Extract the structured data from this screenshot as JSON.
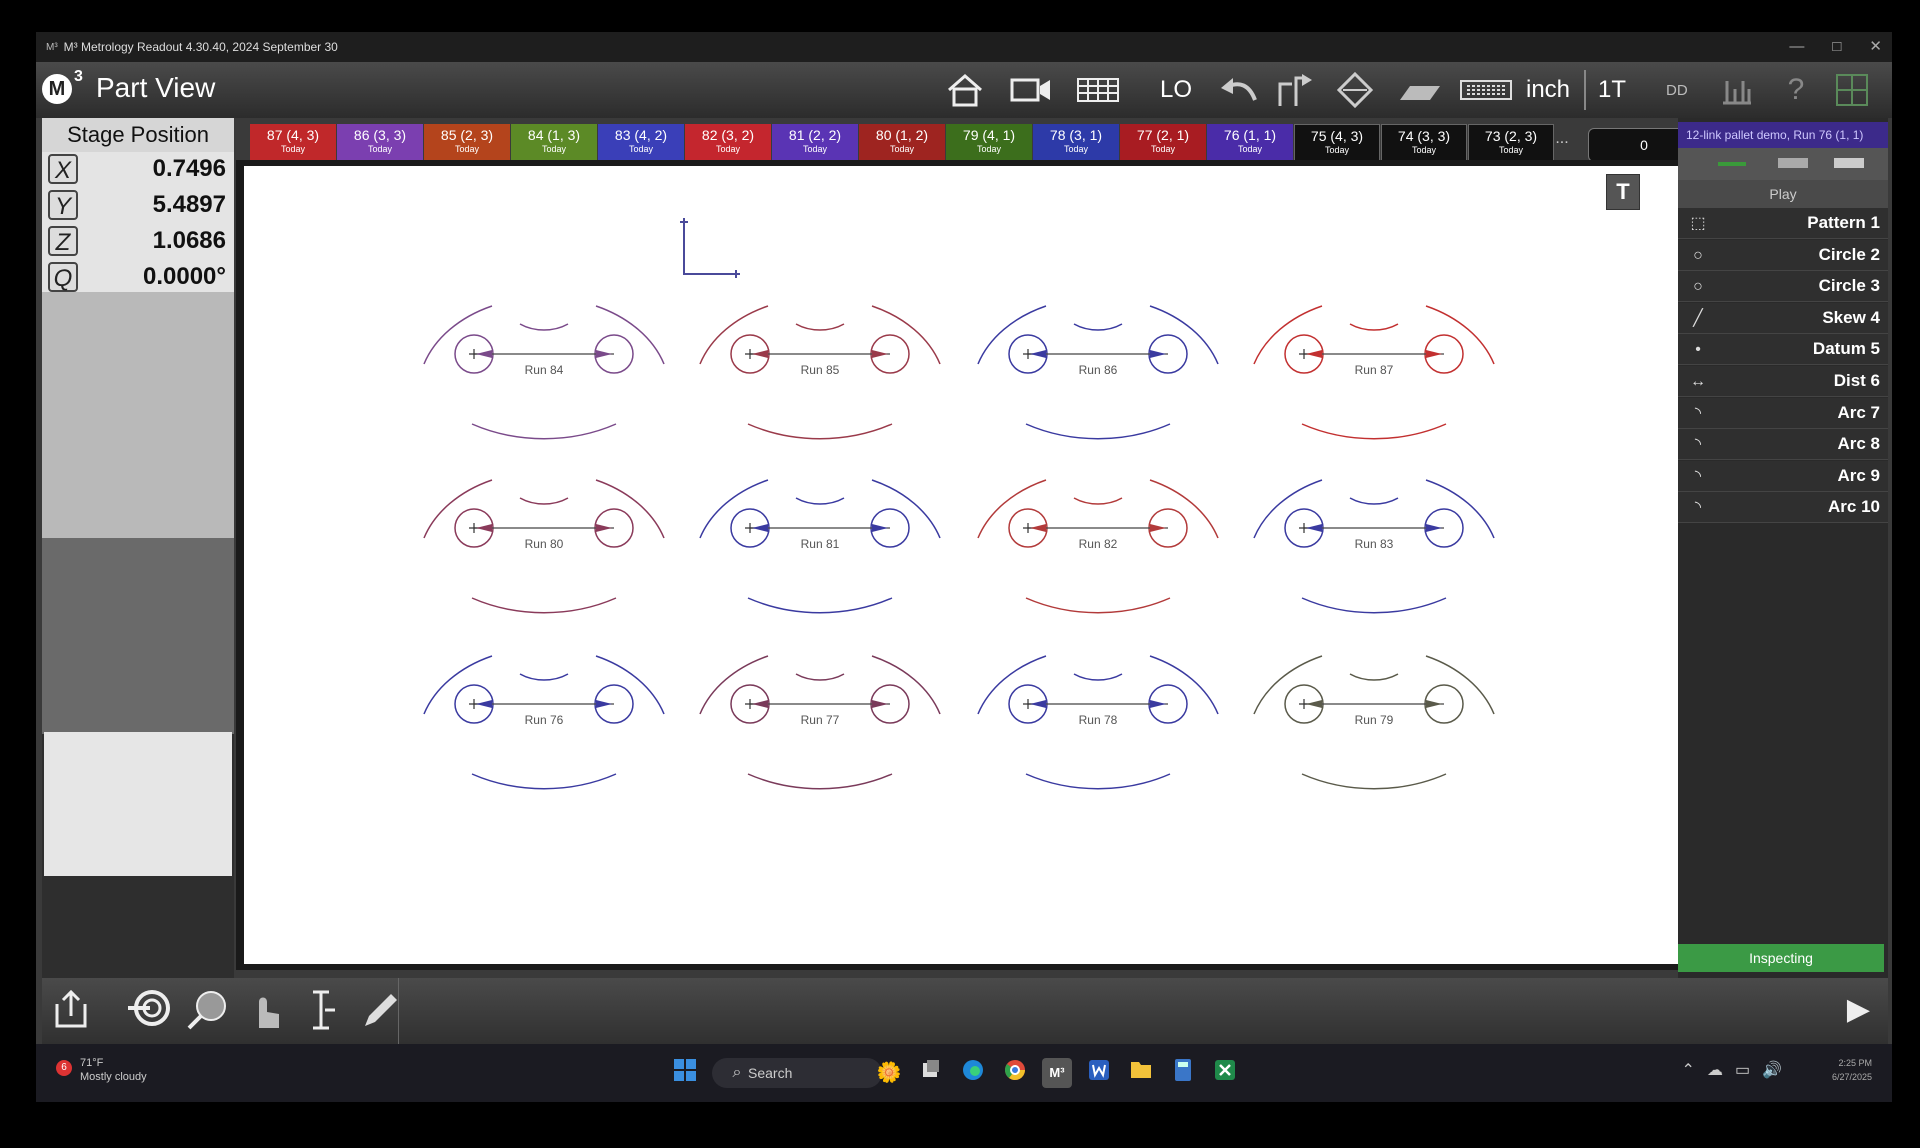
{
  "window": {
    "title": "M³ Metrology Readout  4.30.40, 2024 September 30",
    "controls": [
      "—",
      "□",
      "✕"
    ]
  },
  "header": {
    "logo": "M",
    "logo_sup": "3",
    "view_title": "Part View",
    "mode_text": "LO",
    "units": "inch",
    "probe": "1T",
    "angle_format": "DD"
  },
  "stage": {
    "title": "Stage Position",
    "axes": [
      {
        "axis": "X",
        "value": "0.7496"
      },
      {
        "axis": "Y",
        "value": "5.4897"
      },
      {
        "axis": "Z",
        "value": "1.0686"
      },
      {
        "axis": "Q",
        "value": "0.0000°"
      }
    ]
  },
  "tabs": [
    {
      "label": "87 (4, 3)",
      "sub": "Today",
      "color": "#c0282a"
    },
    {
      "label": "86 (3, 3)",
      "sub": "Today",
      "color": "#7b3fb0"
    },
    {
      "label": "85 (2, 3)",
      "sub": "Today",
      "color": "#b4441c"
    },
    {
      "label": "84 (1, 3)",
      "sub": "Today",
      "color": "#5c8a26"
    },
    {
      "label": "83 (4, 2)",
      "sub": "Today",
      "color": "#3a3fb8"
    },
    {
      "label": "82 (3, 2)",
      "sub": "Today",
      "color": "#c4262e"
    },
    {
      "label": "81 (2, 2)",
      "sub": "Today",
      "color": "#5a34b4"
    },
    {
      "label": "80 (1, 2)",
      "sub": "Today",
      "color": "#9e2420"
    },
    {
      "label": "79 (4, 1)",
      "sub": "Today",
      "color": "#3c6e1c"
    },
    {
      "label": "78 (3, 1)",
      "sub": "Today",
      "color": "#2d3aa8"
    },
    {
      "label": "77 (2, 1)",
      "sub": "Today",
      "color": "#a81c22"
    },
    {
      "label": "76 (1, 1)",
      "sub": "Today",
      "color": "#4a2ca8"
    },
    {
      "label": "75 (4, 3)",
      "sub": "Today",
      "color": "#111111"
    },
    {
      "label": "74 (3, 3)",
      "sub": "Today",
      "color": "#111111"
    },
    {
      "label": "73 (2, 3)",
      "sub": "Today",
      "color": "#111111"
    }
  ],
  "tabs_more": "...",
  "counter": "0",
  "canvas_button": "T",
  "runs": [
    {
      "label": "Run 84",
      "color": "#7a4a8a"
    },
    {
      "label": "Run 85",
      "color": "#9a3a4a"
    },
    {
      "label": "Run 86",
      "color": "#3a3aa0"
    },
    {
      "label": "Run 87",
      "color": "#c23030"
    },
    {
      "label": "Run 80",
      "color": "#8a3a5a"
    },
    {
      "label": "Run 81",
      "color": "#3a3aa0"
    },
    {
      "label": "Run 82",
      "color": "#b23a3a"
    },
    {
      "label": "Run 83",
      "color": "#3a3aa0"
    },
    {
      "label": "Run 76",
      "color": "#3a3aa0"
    },
    {
      "label": "Run 77",
      "color": "#7a3a5a"
    },
    {
      "label": "Run 78",
      "color": "#3a3aa0"
    },
    {
      "label": "Run 79",
      "color": "#5a5a4a"
    }
  ],
  "rightpanel": {
    "header": "12-link pallet demo, Run 76 (1, 1)",
    "play_label": "Play",
    "features": [
      {
        "label": "Pattern 1",
        "icon": "pattern-icon",
        "glyph": "⬚"
      },
      {
        "label": "Circle 2",
        "icon": "circle-icon",
        "glyph": "○"
      },
      {
        "label": "Circle 3",
        "icon": "circle-icon",
        "glyph": "○"
      },
      {
        "label": "Skew 4",
        "icon": "line-icon",
        "glyph": "╱"
      },
      {
        "label": "Datum 5",
        "icon": "point-icon",
        "glyph": "•"
      },
      {
        "label": "Dist 6",
        "icon": "distance-icon",
        "glyph": "↔"
      },
      {
        "label": "Arc 7",
        "icon": "arc-icon",
        "glyph": "◝"
      },
      {
        "label": "Arc 8",
        "icon": "arc-icon",
        "glyph": "◝"
      },
      {
        "label": "Arc 9",
        "icon": "arc-icon",
        "glyph": "◝"
      },
      {
        "label": "Arc 10",
        "icon": "arc-icon",
        "glyph": "◝"
      }
    ],
    "status": "Inspecting"
  },
  "taskbar": {
    "weather_badge": "6",
    "temp": "71°F",
    "condition": "Mostly cloudy",
    "search_placeholder": "Search",
    "time": "2:25 PM",
    "date": "6/27/2025"
  }
}
